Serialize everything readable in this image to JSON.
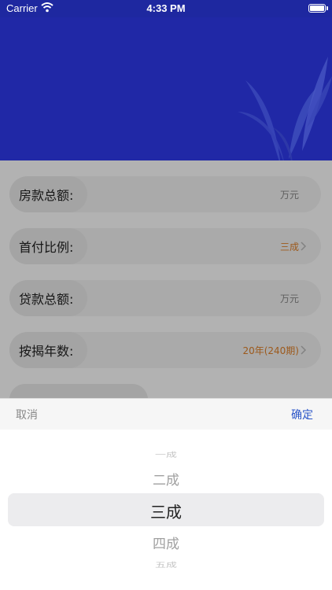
{
  "status_bar": {
    "carrier": "Carrier",
    "time": "4:33 PM"
  },
  "form": {
    "rows": [
      {
        "label": "房款总额:",
        "value": "万元",
        "has_chevron": false
      },
      {
        "label": "首付比例:",
        "value": "三成",
        "has_chevron": true
      },
      {
        "label": "贷款总额:",
        "value": "万元",
        "has_chevron": false
      },
      {
        "label": "按揭年数:",
        "value": "20年(240期)",
        "has_chevron": true
      }
    ]
  },
  "picker": {
    "cancel_label": "取消",
    "confirm_label": "确定",
    "options": [
      "一成",
      "二成",
      "三成",
      "四成",
      "五成"
    ],
    "selected_index": 2
  },
  "colors": {
    "header_blue": "#2028a6",
    "accent_orange": "#e0812a",
    "link_blue": "#2a55c8"
  }
}
